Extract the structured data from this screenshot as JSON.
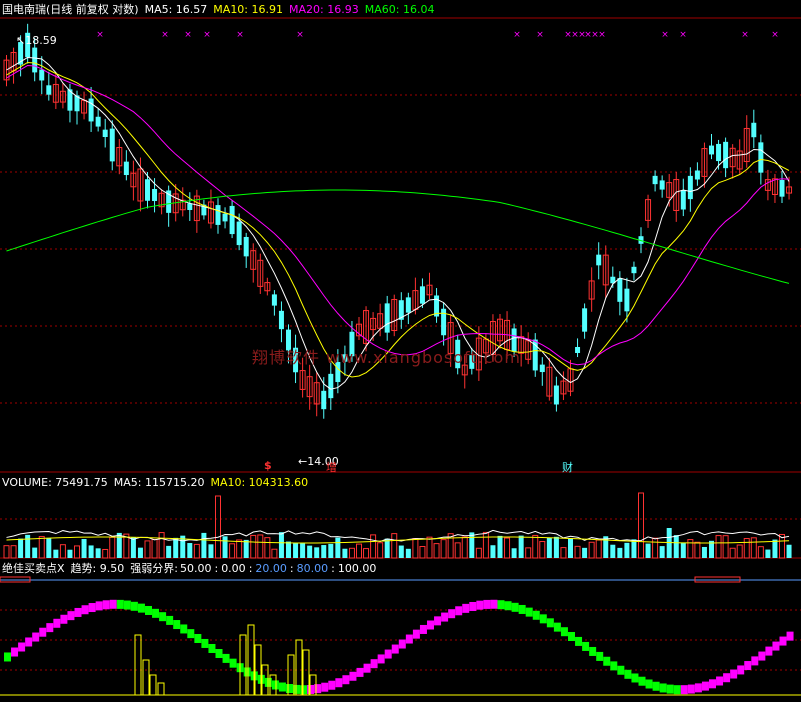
{
  "header": {
    "title": "国电南瑞(日线 前复权 对数)",
    "ma5_label": "MA5: 16.57",
    "ma10_label": "MA10: 16.91",
    "ma20_label": "MA20: 16.93",
    "ma60_label": "MA60: 16.04"
  },
  "price_panel": {
    "high_label": "18.59",
    "low_label": "14.00",
    "watermark": "翔博软件 www.xiangbosoft.com",
    "marker_dollar": "$",
    "marker_zeng": "增",
    "marker_cai": "财"
  },
  "volume_panel": {
    "volume_label": "VOLUME: 75491.75",
    "ma5_label": "MA5: 115715.20",
    "ma10_label": "MA10: 104313.60"
  },
  "indicator_panel": {
    "name_label": "绝佳买卖点X",
    "trend_label": "趋势: 9.50",
    "boundary_title": "强弱分界:",
    "b50": "50.00",
    "b0": "0.00",
    "b20": "20.00",
    "b80": "80.00",
    "b100": "100.00",
    "sep": ":"
  },
  "colors": {
    "up": "#ff3232",
    "down": "#54ffff",
    "ma5": "#ffffff",
    "ma10": "#ffff00",
    "ma20": "#ff00ff",
    "ma60": "#00ff00",
    "grid": "#a00000",
    "header_yellow": "#ffff00",
    "header_magenta": "#ff00ff",
    "header_green": "#00ff00",
    "indicator_blue": "#5a9cff"
  }
}
